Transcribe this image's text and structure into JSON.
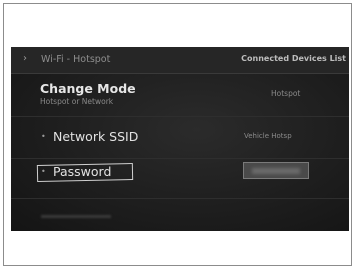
{
  "header": {
    "back_icon": "chevron-right-icon",
    "title": "Wi-Fi - Hotspot",
    "connected_devices_label": "Connected Devices List"
  },
  "change_mode": {
    "title": "Change Mode",
    "subtitle": "Hotspot or Network",
    "value": "Hotspot"
  },
  "network_ssid": {
    "label": "Network SSID",
    "value": "Vehicle Hotsp"
  },
  "password": {
    "label": "Password"
  },
  "colors": {
    "screen_bg": "#1d1d1d",
    "text_primary": "#e2e2e2",
    "text_secondary": "#8a8a8a",
    "highlight_border": "#cfcfcf"
  }
}
